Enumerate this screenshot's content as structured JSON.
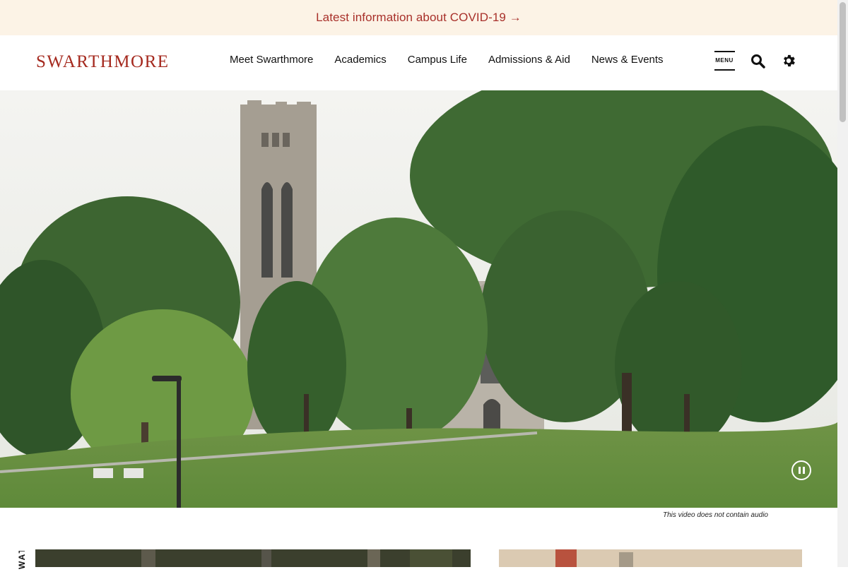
{
  "alert": {
    "text": "Latest information about COVID-19 →"
  },
  "header": {
    "logo_text": "SWARTHMORE",
    "nav": [
      {
        "label": "Meet Swarthmore"
      },
      {
        "label": "Academics"
      },
      {
        "label": "Campus Life"
      },
      {
        "label": "Admissions & Aid"
      },
      {
        "label": "News & Events"
      }
    ],
    "menu_label": "MENU",
    "icons": [
      "menu-icon",
      "search-icon",
      "gear-icon"
    ]
  },
  "hero": {
    "icon": "pause-icon"
  },
  "video_caption": "This video does not contain audio",
  "section": {
    "side_label": "WATCH"
  },
  "colors": {
    "brand": "#a52a1f",
    "alert_bg": "#fcf3e6",
    "alert_text": "#a8302a"
  }
}
